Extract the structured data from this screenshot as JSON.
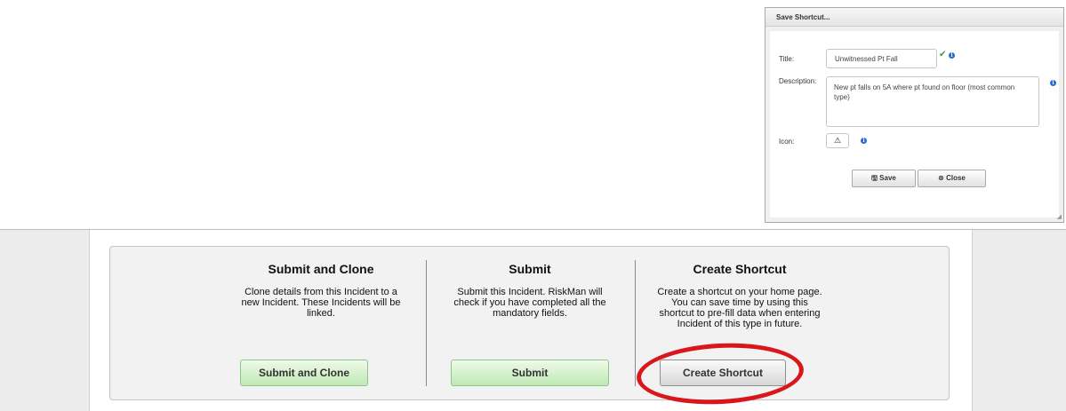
{
  "dialog": {
    "title": "Save Shortcut...",
    "fields": {
      "title_label": "Title:",
      "title_value": "Unwitnessed Pt Fall",
      "description_label": "Description:",
      "description_value": "New pt falls on 5A where pt found on floor (most common type)",
      "icon_label": "Icon:",
      "icon_glyph": "⚠"
    },
    "buttons": {
      "save_label": "Save",
      "close_label": "Close"
    }
  },
  "actions": {
    "columns": [
      {
        "title": "Submit and Clone",
        "description": "Clone details from this Incident to a new Incident. These Incidents will be linked.",
        "button_label": "Submit and Clone",
        "button_style": "green"
      },
      {
        "title": "Submit",
        "description": "Submit this Incident. RiskMan will check if you have completed all the mandatory fields.",
        "button_label": "Submit",
        "button_style": "green"
      },
      {
        "title": "Create Shortcut",
        "description": "Create a shortcut on your home page. You can save time by using this shortcut to pre-fill data when entering Incident of this type in future.",
        "button_label": "Create Shortcut",
        "button_style": "grey"
      }
    ]
  },
  "colors": {
    "highlight": "#d9161b",
    "green_button": "#bfe8b3",
    "info_icon": "#2a6bd1"
  }
}
